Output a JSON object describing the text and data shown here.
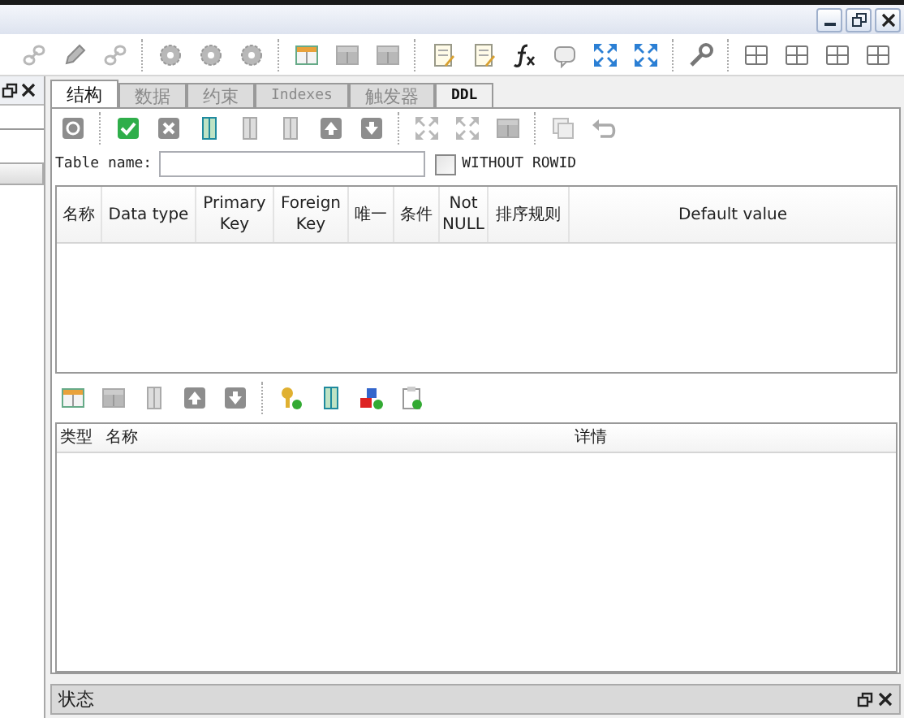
{
  "tabs": [
    {
      "label": "结构",
      "selected": true,
      "disabled": false
    },
    {
      "label": "数据",
      "selected": false,
      "disabled": true
    },
    {
      "label": "约束",
      "selected": false,
      "disabled": true
    },
    {
      "label": "Indexes",
      "selected": false,
      "disabled": true
    },
    {
      "label": "触发器",
      "selected": false,
      "disabled": true
    },
    {
      "label": "DDL",
      "selected": false,
      "disabled": false
    }
  ],
  "table_name": {
    "label": "Table name:"
  },
  "without_rowid": {
    "label": "WITHOUT ROWID",
    "checked": false
  },
  "fields_table": {
    "columns": [
      "名称",
      "Data type",
      "Primary Key",
      "Foreign Key",
      "唯一",
      "条件",
      "Not NULL",
      "排序规则",
      "Default value"
    ]
  },
  "indexes_table": {
    "columns": [
      "类型",
      "名称",
      "详情"
    ]
  },
  "status_panel": {
    "title": "状态"
  }
}
